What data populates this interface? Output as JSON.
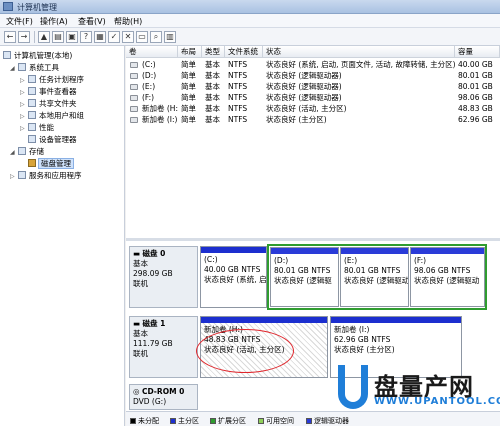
{
  "window": {
    "title": "计算机管理"
  },
  "menu": {
    "file": "文件(F)",
    "action": "操作(A)",
    "view": "查看(V)",
    "help": "帮助(H)"
  },
  "nav": {
    "root": "计算机管理(本地)",
    "system_tools": "系统工具",
    "task_scheduler": "任务计划程序",
    "event_viewer": "事件查看器",
    "shared_folders": "共享文件夹",
    "local_users": "本地用户和组",
    "performance": "性能",
    "device_manager": "设备管理器",
    "storage": "存储",
    "disk_management": "磁盘管理",
    "services": "服务和应用程序"
  },
  "columns": {
    "vol": "卷",
    "layout": "布局",
    "type": "类型",
    "fs": "文件系统",
    "status": "状态",
    "capacity": "容量"
  },
  "volumes": [
    {
      "vol": "(C:)",
      "layout": "简单",
      "type": "基本",
      "fs": "NTFS",
      "status": "状态良好 (系统, 启动, 页面文件, 活动, 故障转储, 主分区)",
      "capacity": "40.00 GB"
    },
    {
      "vol": "(D:)",
      "layout": "简单",
      "type": "基本",
      "fs": "NTFS",
      "status": "状态良好 (逻辑驱动器)",
      "capacity": "80.01 GB"
    },
    {
      "vol": "(E:)",
      "layout": "简单",
      "type": "基本",
      "fs": "NTFS",
      "status": "状态良好 (逻辑驱动器)",
      "capacity": "80.01 GB"
    },
    {
      "vol": "(F:)",
      "layout": "简单",
      "type": "基本",
      "fs": "NTFS",
      "status": "状态良好 (逻辑驱动器)",
      "capacity": "98.06 GB"
    },
    {
      "vol": "新加卷 (H:)",
      "layout": "简单",
      "type": "基本",
      "fs": "NTFS",
      "status": "状态良好 (活动, 主分区)",
      "capacity": "48.83 GB"
    },
    {
      "vol": "新加卷 (I:)",
      "layout": "简单",
      "type": "基本",
      "fs": "NTFS",
      "status": "状态良好 (主分区)",
      "capacity": "62.96 GB"
    }
  ],
  "disks": {
    "disk0": {
      "name": "磁盘 0",
      "type": "基本",
      "size": "298.09 GB",
      "state": "联机"
    },
    "disk1": {
      "name": "磁盘 1",
      "type": "基本",
      "size": "111.79 GB",
      "state": "联机"
    },
    "cdrom": {
      "name": "CD-ROM 0",
      "sub": "DVD (G:)"
    }
  },
  "partitions": {
    "c": {
      "label": "(C:)",
      "size": "40.00 GB NTFS",
      "status": "状态良好 (系统, 启动"
    },
    "d": {
      "label": "(D:)",
      "size": "80.01 GB NTFS",
      "status": "状态良好 (逻辑驱"
    },
    "e": {
      "label": "(E:)",
      "size": "80.01 GB NTFS",
      "status": "状态良好 (逻辑驱动"
    },
    "f": {
      "label": "(F:)",
      "size": "98.06 GB NTFS",
      "status": "状态良好 (逻辑驱动"
    },
    "h": {
      "label": "新加卷 (H:)",
      "size": "48.83 GB NTFS",
      "status": "状态良好 (活动, 主分区)"
    },
    "i": {
      "label": "新加卷 (I:)",
      "size": "62.96 GB NTFS",
      "status": "状态良好 (主分区)"
    }
  },
  "legend": {
    "unallocated": "未分配",
    "primary": "主分区",
    "extended": "扩展分区",
    "free": "可用空间",
    "logical": "逻辑驱动器"
  },
  "colors": {
    "primary": "#1c2fcf",
    "unallocated": "#000000",
    "extended": "#2f9c2f",
    "free": "#8fd05a",
    "logical": "#2a3bd8",
    "highlight": "#e0262c"
  },
  "watermark": {
    "brand": "盘量产网",
    "url": "WWW.UPANTOOL.COM"
  }
}
